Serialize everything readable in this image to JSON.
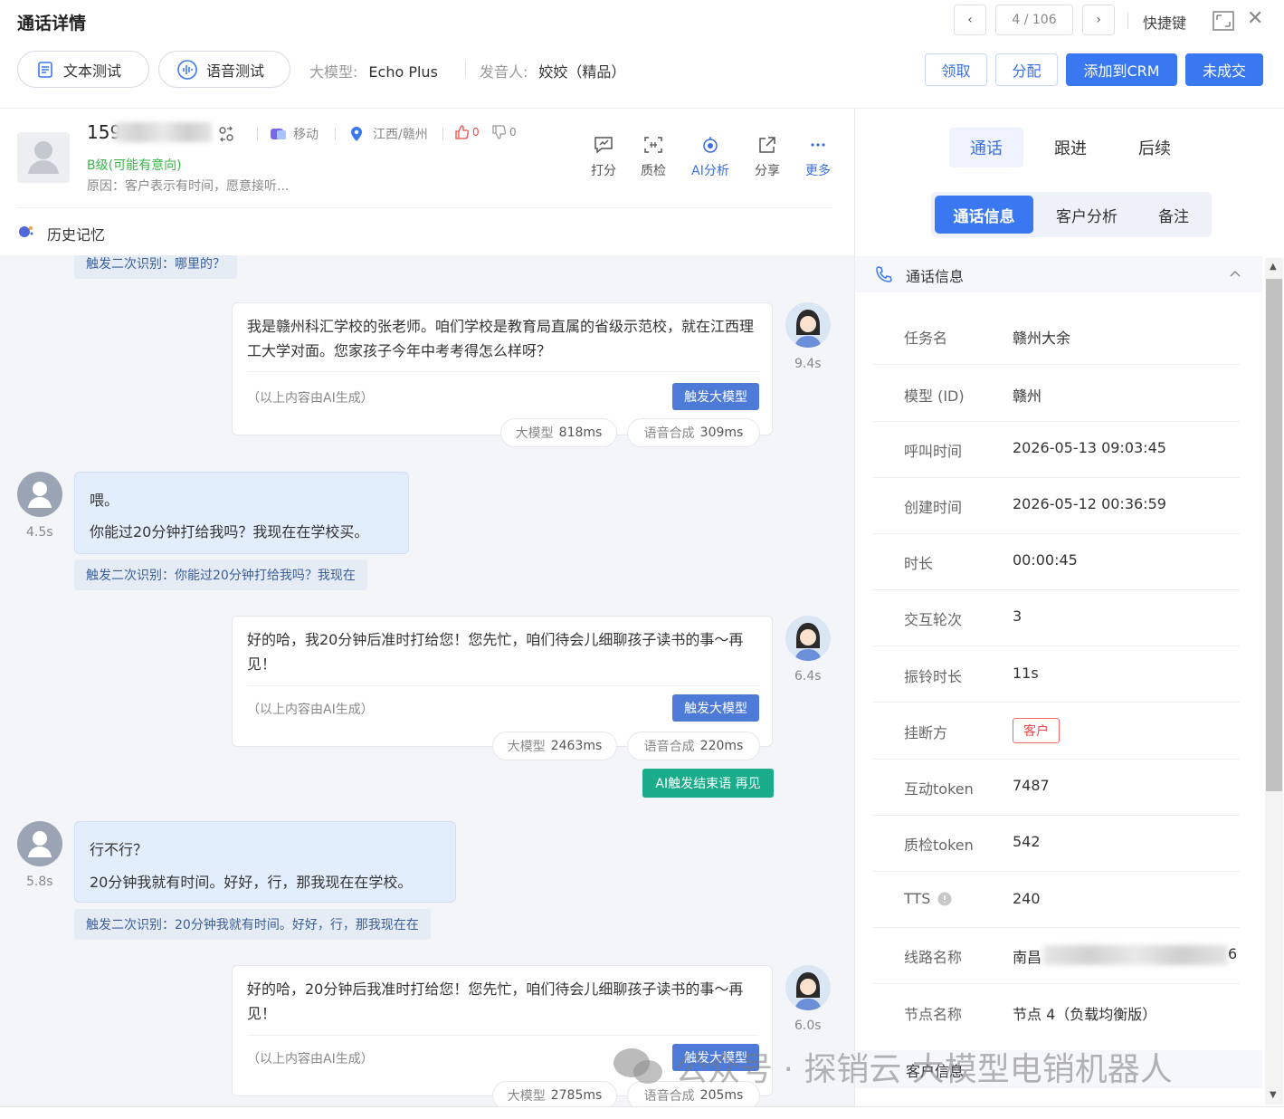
{
  "header": {
    "title": "通话详情",
    "pager": "4 / 106",
    "shortcut": "快捷键"
  },
  "toolbar": {
    "text_test": "文本测试",
    "voice_test": "语音测试",
    "model_label": "大模型:",
    "model_value": "Echo Plus",
    "speaker_label": "发音人:",
    "speaker_value": "姣姣（精品）",
    "claim": "领取",
    "assign": "分配",
    "add_crm": "添加到CRM",
    "not_deal": "未成交"
  },
  "contact": {
    "phone_prefix": "159",
    "carrier": "移动",
    "location": "江西/赣州",
    "likes": "0",
    "dislikes": "0",
    "grade": "B级(可能有意向)",
    "reason": "原因：客户表示有时间，愿意接听...",
    "tools": [
      "打分",
      "质检",
      "AI分析",
      "分享",
      "更多"
    ],
    "history": "历史记忆"
  },
  "chat": {
    "ai_note": "（以上内容由AI生成）",
    "llm_button": "触发大模型",
    "llm_metric_label": "大模型",
    "tts_metric_label": "语音合成",
    "triggers": [
      "触发二次识别：哪里的？",
      "触发二次识别：你能过20分钟打给我吗？我现在",
      "触发二次识别：20分钟我就有时间。好好，行，那我现在在"
    ],
    "bot_messages": [
      {
        "text": "我是赣州科汇学校的张老师。咱们学校是教育局直属的省级示范校，就在江西理工大学对面。您家孩子今年中考考得怎么样呀？",
        "dur": "9.4s",
        "llm": "818ms",
        "tts": "309ms"
      },
      {
        "text": "好的哈，我20分钟后准时打给您！您先忙，咱们待会儿细聊孩子读书的事～再见！",
        "dur": "6.4s",
        "llm": "2463ms",
        "tts": "220ms"
      },
      {
        "text": "好的哈，20分钟后我准时打给您！您先忙，咱们待会儿细聊孩子读书的事～再见！",
        "dur": "6.0s",
        "llm": "2785ms",
        "tts": "205ms"
      }
    ],
    "user_messages": [
      {
        "line1": "喂。",
        "line2": "你能过20分钟打给我吗？我现在在学校买。",
        "dur": "4.5s"
      },
      {
        "line1": "行不行？",
        "line2": "20分钟我就有时间。好好，行，那我现在在学校。",
        "dur": "5.8s"
      }
    ],
    "end_tag": "AI触发结束语 再见"
  },
  "right": {
    "tabs": [
      "通话",
      "跟进",
      "后续"
    ],
    "segments": [
      "通话信息",
      "客户分析",
      "备注"
    ],
    "section": "通话信息",
    "rows": [
      {
        "k": "任务名",
        "v": "赣州大余"
      },
      {
        "k": "模型 (ID)",
        "v": "赣州"
      },
      {
        "k": "呼叫时间",
        "v": "2026-05-13 09:03:45"
      },
      {
        "k": "创建时间",
        "v": "2026-05-12 00:36:59"
      },
      {
        "k": "时长",
        "v": "00:00:45"
      },
      {
        "k": "交互轮次",
        "v": "3"
      },
      {
        "k": "振铃时长",
        "v": "11s"
      },
      {
        "k": "挂断方",
        "v": "客户"
      },
      {
        "k": "互动token",
        "v": "7487"
      },
      {
        "k": "质检token",
        "v": "542"
      },
      {
        "k": "TTS",
        "v": "240"
      },
      {
        "k": "线路名称",
        "v": "南昌",
        "v_tail": "6"
      },
      {
        "k": "节点名称",
        "v": "节点 4（负载均衡版）"
      }
    ],
    "customer_section": "客户信息"
  },
  "watermark": "公众号 · 探销云 大模型电销机器人",
  "colors": {
    "primary": "#3a78f2",
    "green": "#39b54a",
    "teal": "#1aab8a",
    "red": "#f04848"
  }
}
